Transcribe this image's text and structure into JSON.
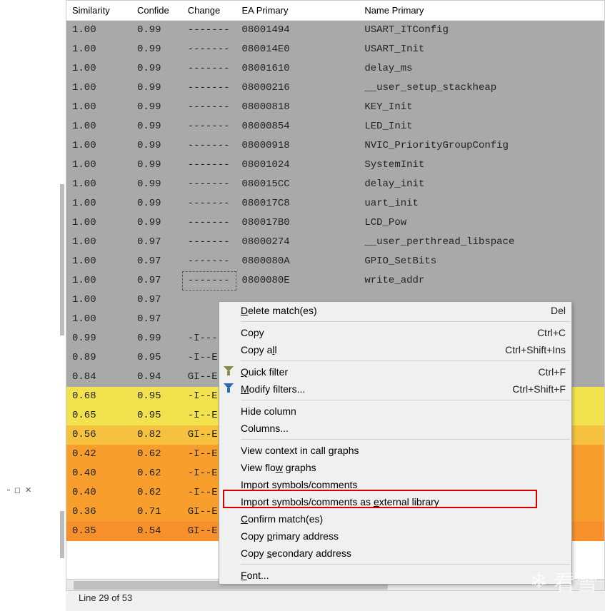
{
  "columns": [
    "Similarity",
    "Confide",
    "Change",
    "EA Primary",
    "Name Primary"
  ],
  "rows": [
    {
      "sim": "1.00",
      "conf": "0.99",
      "chg": "-------",
      "ea": "08001494",
      "name": "USART_ITConfig",
      "cls": "r-gray"
    },
    {
      "sim": "1.00",
      "conf": "0.99",
      "chg": "-------",
      "ea": "080014E0",
      "name": "USART_Init",
      "cls": "r-gray"
    },
    {
      "sim": "1.00",
      "conf": "0.99",
      "chg": "-------",
      "ea": "08001610",
      "name": "delay_ms",
      "cls": "r-gray"
    },
    {
      "sim": "1.00",
      "conf": "0.99",
      "chg": "-------",
      "ea": "08000216",
      "name": "__user_setup_stackheap",
      "cls": "r-gray"
    },
    {
      "sim": "1.00",
      "conf": "0.99",
      "chg": "-------",
      "ea": "08000818",
      "name": "KEY_Init",
      "cls": "r-gray"
    },
    {
      "sim": "1.00",
      "conf": "0.99",
      "chg": "-------",
      "ea": "08000854",
      "name": "LED_Init",
      "cls": "r-gray"
    },
    {
      "sim": "1.00",
      "conf": "0.99",
      "chg": "-------",
      "ea": "08000918",
      "name": "NVIC_PriorityGroupConfig",
      "cls": "r-gray"
    },
    {
      "sim": "1.00",
      "conf": "0.99",
      "chg": "-------",
      "ea": "08001024",
      "name": "SystemInit",
      "cls": "r-gray"
    },
    {
      "sim": "1.00",
      "conf": "0.99",
      "chg": "-------",
      "ea": "080015CC",
      "name": "delay_init",
      "cls": "r-gray"
    },
    {
      "sim": "1.00",
      "conf": "0.99",
      "chg": "-------",
      "ea": "080017C8",
      "name": "uart_init",
      "cls": "r-gray"
    },
    {
      "sim": "1.00",
      "conf": "0.99",
      "chg": "-------",
      "ea": "080017B0",
      "name": "LCD_Pow",
      "cls": "r-gray"
    },
    {
      "sim": "1.00",
      "conf": "0.97",
      "chg": "-------",
      "ea": "08000274",
      "name": "__user_perthread_libspace",
      "cls": "r-gray"
    },
    {
      "sim": "1.00",
      "conf": "0.97",
      "chg": "-------",
      "ea": "0800080A",
      "name": "GPIO_SetBits",
      "cls": "r-gray"
    },
    {
      "sim": "1.00",
      "conf": "0.97",
      "chg": "-------",
      "ea": "0800080E",
      "name": "write_addr",
      "cls": "r-gray",
      "sel": true
    },
    {
      "sim": "1.00",
      "conf": "0.97",
      "chg": "",
      "ea": "",
      "name": "",
      "cls": "r-gray"
    },
    {
      "sim": "1.00",
      "conf": "0.97",
      "chg": "",
      "ea": "",
      "name": "",
      "cls": "r-gray"
    },
    {
      "sim": "0.99",
      "conf": "0.99",
      "chg": "-I----",
      "ea": "",
      "name": "",
      "cls": "r-gray"
    },
    {
      "sim": "0.89",
      "conf": "0.95",
      "chg": "-I--E-",
      "ea": "",
      "name": "",
      "cls": "r-gray"
    },
    {
      "sim": "0.84",
      "conf": "0.94",
      "chg": "GI--E-",
      "ea": "",
      "name": "",
      "cls": "r-gray"
    },
    {
      "sim": "0.68",
      "conf": "0.95",
      "chg": "-I--E-",
      "ea": "",
      "name": "",
      "cls": "r-yellow"
    },
    {
      "sim": "0.65",
      "conf": "0.95",
      "chg": "-I--E-",
      "ea": "",
      "name": "",
      "cls": "r-yellow"
    },
    {
      "sim": "0.56",
      "conf": "0.82",
      "chg": "GI--E-",
      "ea": "",
      "name": "",
      "cls": "r-gold"
    },
    {
      "sim": "0.42",
      "conf": "0.62",
      "chg": "-I--E-",
      "ea": "",
      "name": "",
      "cls": "r-orange"
    },
    {
      "sim": "0.40",
      "conf": "0.62",
      "chg": "-I--E-",
      "ea": "",
      "name": "",
      "cls": "r-orange"
    },
    {
      "sim": "0.40",
      "conf": "0.62",
      "chg": "-I--E-",
      "ea": "",
      "name": "",
      "cls": "r-orange"
    },
    {
      "sim": "0.36",
      "conf": "0.71",
      "chg": "GI--E-",
      "ea": "",
      "name": "",
      "cls": "r-orange"
    },
    {
      "sim": "0.35",
      "conf": "0.54",
      "chg": "GI--E-",
      "ea": "",
      "name": "",
      "cls": "r-orange2"
    }
  ],
  "menu": {
    "delete": "Delete match(es)",
    "delete_sc": "Del",
    "copy": "Copy",
    "copy_sc": "Ctrl+C",
    "copy_all": "Copy all",
    "copy_all_sc": "Ctrl+Shift+Ins",
    "quick_filter": "Quick filter",
    "quick_filter_sc": "Ctrl+F",
    "modify_filters": "Modify filters...",
    "modify_filters_sc": "Ctrl+Shift+F",
    "hide_column": "Hide column",
    "columns": "Columns...",
    "view_context": "View context in call graphs",
    "view_flow": "View flow graphs",
    "import_sym": "Import symbols/comments",
    "import_ext": "Import symbols/comments as external library",
    "confirm": "Confirm match(es)",
    "copy_primary": "Copy primary address",
    "copy_secondary": "Copy secondary address",
    "font": "Font..."
  },
  "status": "Line 29 of 53",
  "watermark": "看雪",
  "dock": {
    "min": "▫",
    "max": "◻",
    "close": "✕"
  }
}
